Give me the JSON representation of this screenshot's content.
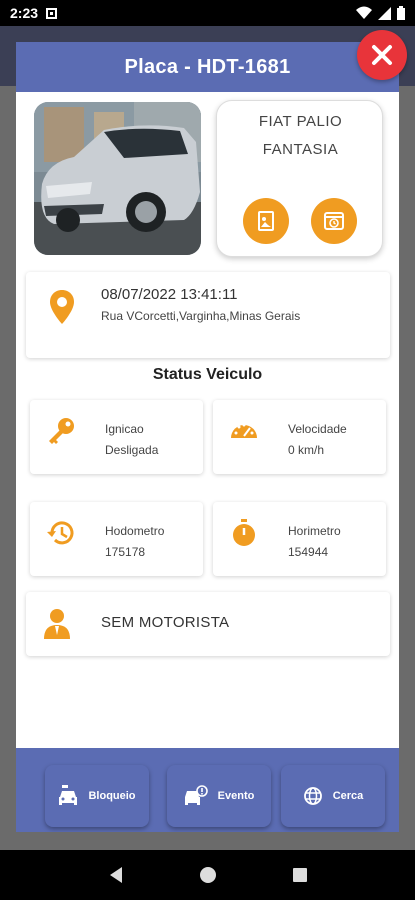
{
  "status_bar": {
    "time": "2:23"
  },
  "header": {
    "title": "Placa - HDT-1681"
  },
  "vehicle": {
    "model_line1": "FIAT PALIO",
    "model_line2": "FANTASIA"
  },
  "location": {
    "datetime": "08/07/2022 13:41:11",
    "address": "Rua VCorcetti,Varginha,Minas Gerais"
  },
  "status_section": {
    "title": "Status Veiculo"
  },
  "stats": {
    "ignition": {
      "label": "Ignicao",
      "value": "Desligada"
    },
    "speed": {
      "label": "Velocidade",
      "value": "0 km/h"
    },
    "odometer": {
      "label": "Hodometro",
      "value": "175178"
    },
    "hourmeter": {
      "label": "Horimetro",
      "value": "154944"
    }
  },
  "driver": {
    "label": "SEM MOTORISTA"
  },
  "bottom_actions": {
    "block_label": "Bloqueio",
    "event_label": "Evento",
    "fence_label": "Cerca"
  },
  "colors": {
    "primary": "#5b6cb3",
    "accent": "#f09c21",
    "close": "#e8343a"
  }
}
